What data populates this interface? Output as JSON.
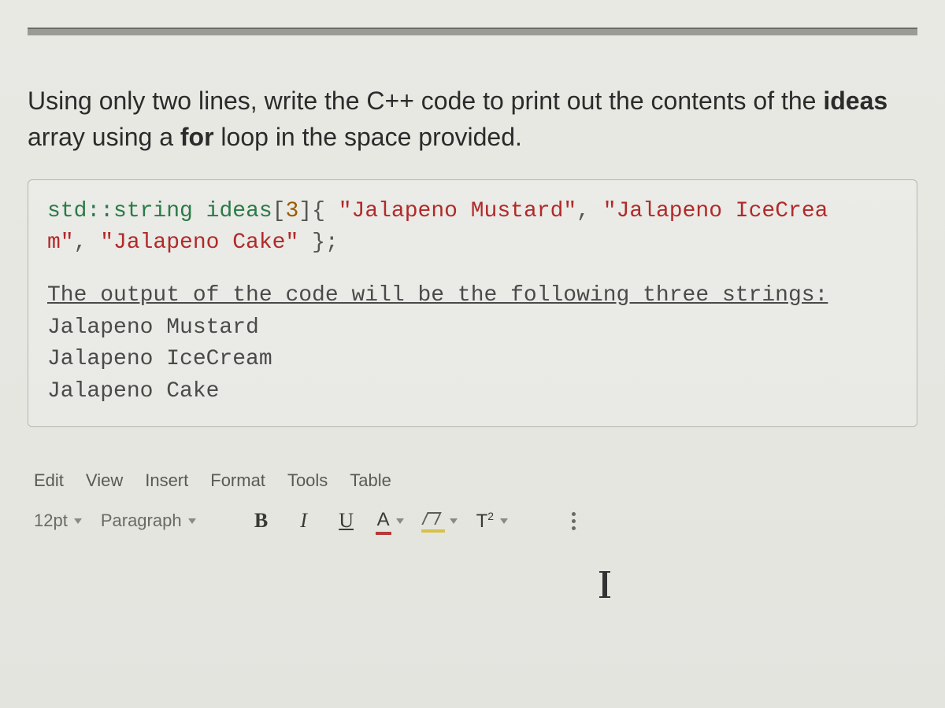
{
  "question": {
    "line1_pre": "Using only two lines, write the C++ code to print out the contents of the ",
    "line2_bold1": "ideas",
    "line2_mid": " array using a ",
    "line2_bold2": "for",
    "line2_post": " loop in the space provided."
  },
  "code": {
    "decl_type": "std::string",
    "decl_name": "ideas",
    "decl_open": "[",
    "decl_size": "3",
    "decl_close": "]{ ",
    "str1": "\"Jalapeno Mustard\"",
    "sep1": ", ",
    "str2a": "\"Jalapeno IceCrea",
    "str2b": "m\"",
    "sep2": ", ",
    "str3": "\"Jalapeno Cake\"",
    "decl_end": " };",
    "out_header": "The output of the code will be the following three strings:",
    "out1": "Jalapeno Mustard",
    "out2": "Jalapeno IceCream",
    "out3": "Jalapeno Cake"
  },
  "editor": {
    "menu": [
      "Edit",
      "View",
      "Insert",
      "Format",
      "Tools",
      "Table"
    ],
    "font_size": "12pt",
    "style": "Paragraph",
    "super_label": "T",
    "super_exp": "2"
  }
}
